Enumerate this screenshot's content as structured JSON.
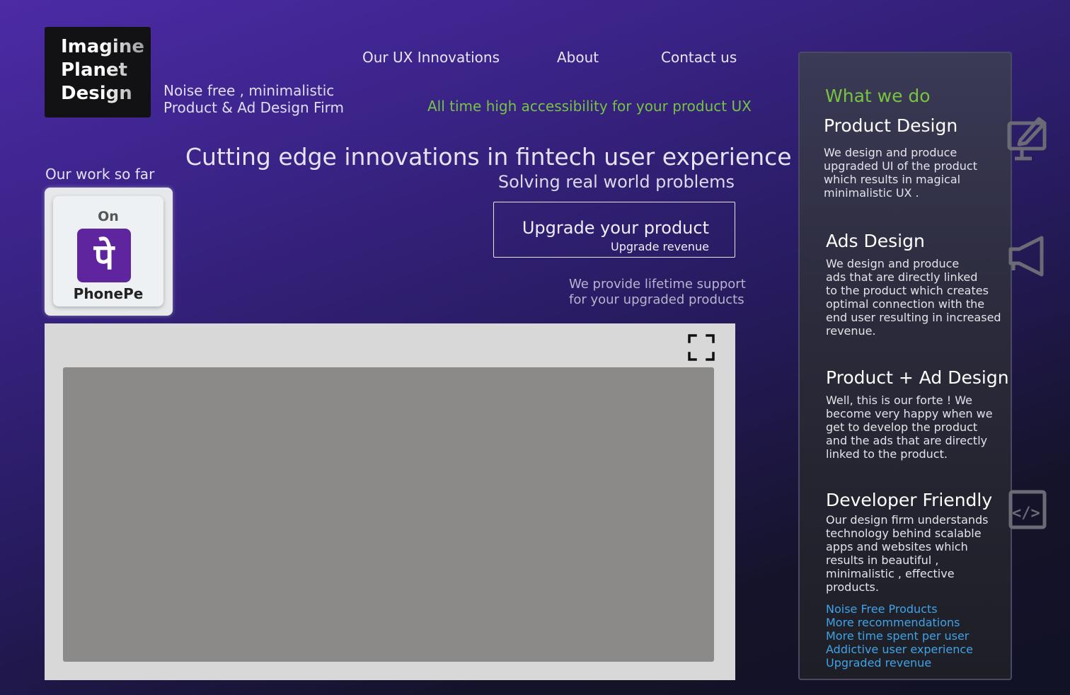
{
  "brand": {
    "logo_lines": [
      "Imagine",
      "Planet",
      "Design"
    ],
    "tagline_lines": [
      "Noise free , minimalistic",
      "Product & Ad Design Firm"
    ]
  },
  "nav": {
    "items": [
      "Our UX Innovations",
      "About",
      "Contact us"
    ]
  },
  "accessibility_text": "All time high accessibility for your product UX",
  "hero": {
    "title": "Cutting edge innovations in fintech user experience",
    "subtitle": "Solving real world problems"
  },
  "work": {
    "label": "Our work so far",
    "card_prefix": "On",
    "card_icon_glyph": "पे",
    "card_name": "PhonePe",
    "brand_color": "#5f259f"
  },
  "cta": {
    "main": "Upgrade your product",
    "sub": "Upgrade revenue"
  },
  "support_lines": [
    "We provide lifetime support",
    "for your upgraded products"
  ],
  "media": {
    "fullscreen_icon": "fullscreen-icon"
  },
  "services": {
    "heading": "What we do",
    "items": [
      {
        "title": "Product Design",
        "body_lines": [
          "We design and produce",
          "upgraded UI of the product",
          "which results in magical",
          "minimalistic UX ."
        ],
        "icon": "monitor-edit-icon"
      },
      {
        "title": "Ads Design",
        "body_lines": [
          "We design and produce",
          "ads that are directly linked",
          "to the product which creates",
          "optimal connection with the",
          "end user resulting in increased",
          "revenue."
        ],
        "icon": "megaphone-icon"
      },
      {
        "title": "Product + Ad Design",
        "body_lines": [
          "Well, this is our forte ! We",
          "become very happy when we",
          "get to develop the product",
          "and the ads that are directly",
          "linked to the product."
        ]
      },
      {
        "title": "Developer Friendly",
        "body_lines": [
          "Our design firm understands",
          "technology behind scalable",
          "apps and websites which",
          "results in beautiful ,",
          "minimalistic , effective",
          "products."
        ],
        "icon": "code-icon"
      }
    ],
    "benefits": [
      "Noise Free Products",
      "More recommendations",
      "More time spent per user",
      "Addictive user experience",
      "Upgraded revenue"
    ]
  },
  "colors": {
    "accent_green": "#76c442",
    "link_blue": "#3fa3e6"
  }
}
